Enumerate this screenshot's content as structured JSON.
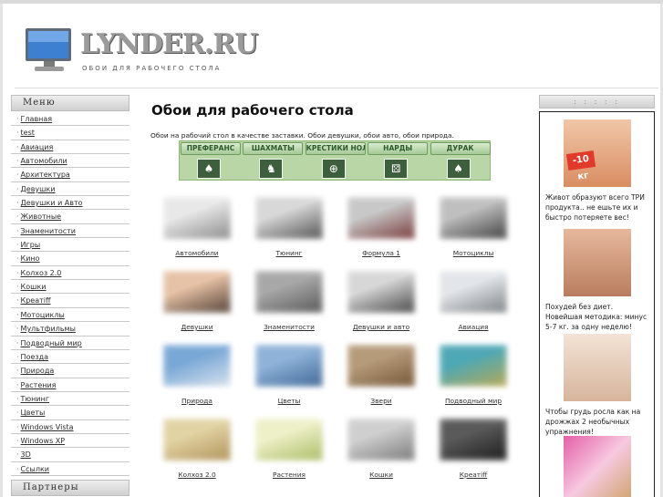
{
  "site": {
    "logo_text": "LYNDER.RU",
    "tagline": "ОБОИ ДЛЯ РАБОЧЕГО СТОЛА"
  },
  "sidebar": {
    "menu_title": "Меню",
    "items": [
      "Главная",
      "test",
      "Авиация",
      "Автомобили",
      "Архитектура",
      "Девушки",
      "Девушки и Авто",
      "Животные",
      "Знаменитости",
      "Игры",
      "Кино",
      "Колхоз 2.0",
      "Кошки",
      "Креатiff",
      "Мотоциклы",
      "Мультфильмы",
      "Подводный мир",
      "Поезда",
      "Природа",
      "Растения",
      "Тюнинг",
      "Цветы",
      "Windows Vista",
      "Windows XP",
      "3D",
      "Ссылки"
    ],
    "partners_title": "Партнеры"
  },
  "main": {
    "title": "Обои для рабочего стола",
    "intro": "Обои на рабочий стол в качестве заставки. Обои девушки, обои авто, обои природа.",
    "games": [
      {
        "label": "ПРЕФЕРАНС",
        "icon": "cards-icon"
      },
      {
        "label": "ШАХМАТЫ",
        "icon": "chess-icon"
      },
      {
        "label": "КРЕСТИКИ НОЛИКИ",
        "icon": "tictactoe-icon"
      },
      {
        "label": "НАРДЫ",
        "icon": "backgammon-icon"
      },
      {
        "label": "ДУРАК",
        "icon": "cards-icon"
      }
    ],
    "thumbs": [
      {
        "caption": "Автомобили",
        "colors": [
          "#e8e8e8",
          "#7a7a7a"
        ]
      },
      {
        "caption": "Тюнинг",
        "colors": [
          "#d8d8d8",
          "#3a3a3a"
        ]
      },
      {
        "caption": "Формула 1",
        "colors": [
          "#c8c8c8",
          "#6a2020"
        ]
      },
      {
        "caption": "Мотоциклы",
        "colors": [
          "#bfbfbf",
          "#2a2a2a"
        ]
      },
      {
        "caption": "Девушки",
        "colors": [
          "#e6c2a6",
          "#3a2a22"
        ]
      },
      {
        "caption": "Знаменитости",
        "colors": [
          "#a8a8a8",
          "#4a4a4a"
        ]
      },
      {
        "caption": "Девушки и авто",
        "colors": [
          "#d7d7d7",
          "#2d2d2d"
        ]
      },
      {
        "caption": "Авиация",
        "colors": [
          "#e2e6ea",
          "#6d7177"
        ]
      },
      {
        "caption": "Природа",
        "colors": [
          "#7aa8d6",
          "#e9edf2"
        ]
      },
      {
        "caption": "Цветы",
        "colors": [
          "#8fb2d8",
          "#315c8b"
        ]
      },
      {
        "caption": "Звери",
        "colors": [
          "#b59b7a",
          "#6b4a2c"
        ]
      },
      {
        "caption": "Подводный мир",
        "colors": [
          "#4ea8b5",
          "#c9a944"
        ]
      },
      {
        "caption": "Колхоз 2.0",
        "colors": [
          "#e2d3a4",
          "#a8874b"
        ]
      },
      {
        "caption": "Растения",
        "colors": [
          "#eef0c8",
          "#9fb454"
        ]
      },
      {
        "caption": "Кошки",
        "colors": [
          "#cfcfcf",
          "#6b6b6b"
        ]
      },
      {
        "caption": "Креатiff",
        "colors": [
          "#5a5a5a",
          "#111111"
        ]
      }
    ]
  },
  "right": {
    "head": ": : : : :",
    "ads": [
      {
        "text": "Живот образуют всего ТРИ продукта.. не ешьте их и быстро потеряете вес!",
        "badge": "-10 кг"
      },
      {
        "text": "Похудей без диет. Новейшая методика: минус 5-7 кг. за одну неделю!"
      },
      {
        "text": "Чтобы грудь росла как на дрожжах 2 необычных упражнения!"
      }
    ]
  }
}
